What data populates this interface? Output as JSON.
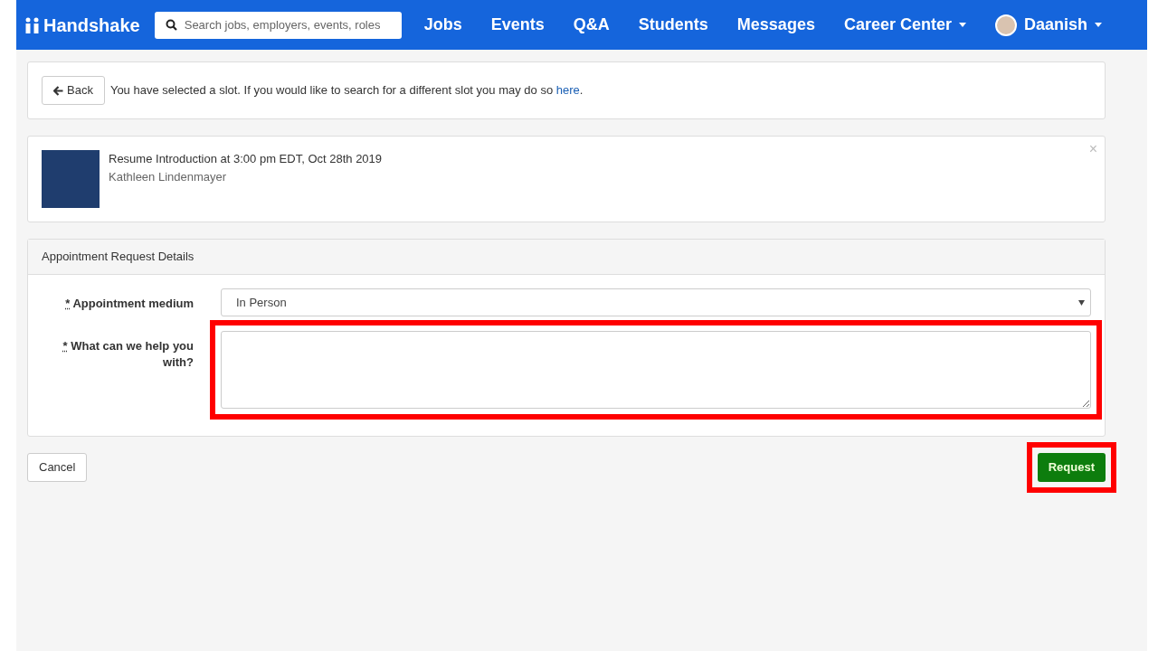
{
  "nav": {
    "logo": "Handshake",
    "search": {
      "placeholder": "Search jobs, employers, events, roles"
    },
    "items": [
      {
        "label": "Jobs",
        "dropdown": false
      },
      {
        "label": "Events",
        "dropdown": false
      },
      {
        "label": "Q&A",
        "dropdown": false
      },
      {
        "label": "Students",
        "dropdown": false
      },
      {
        "label": "Messages",
        "dropdown": false
      },
      {
        "label": "Career Center",
        "dropdown": true
      }
    ],
    "user": {
      "name": "Daanish",
      "dropdown": true
    }
  },
  "slot_notice": {
    "back_button": "Back",
    "message": "You have selected a slot. If you would like to search for a different slot you may do so ",
    "link": "here",
    "message_end": "."
  },
  "appointment": {
    "title": "Resume Introduction at 3:00 pm EDT, Oct 28th 2019",
    "staff": "Kathleen Lindenmayer",
    "close": "×"
  },
  "details": {
    "title": "Appointment Request Details",
    "fields": [
      {
        "kind": "select",
        "required_mark": "*",
        "label": "Appointment medium",
        "value": "In Person"
      },
      {
        "kind": "textarea",
        "required_mark": "*",
        "label": "What can we help you with?",
        "highlighted": true
      }
    ]
  },
  "actions": {
    "cancel": {
      "label": "Cancel"
    },
    "submit": {
      "label": "Request",
      "highlighted": true
    }
  }
}
